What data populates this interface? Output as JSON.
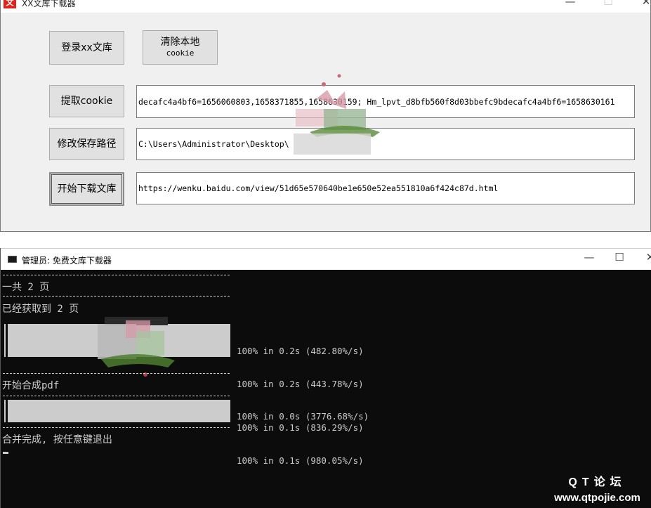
{
  "gui": {
    "title": "XX文库下载器",
    "app_icon_glyph": "文",
    "controls": {
      "minimize": "—",
      "maximize": "☐",
      "close": "✕"
    },
    "buttons": {
      "login": "登录xx文库",
      "clear_line1": "清除本地",
      "clear_line2": "cookie",
      "get_cookie": "提取cookie",
      "change_path": "修改保存路径",
      "start_download": "开始下载文库"
    },
    "fields": {
      "cookie": "decafc4a4bf6=1656060803,1658371855,1658630159; Hm_lpvt_d8bfb560f8d03bbefc9bdecafc4a4bf6=1658630161",
      "path": "C:\\Users\\Administrator\\Desktop\\",
      "url": "https://wenku.baidu.com/view/51d65e570640be1e650e52ea551810a6f424c87d.html"
    }
  },
  "console": {
    "title": "管理员:  免费文库下载器",
    "controls": {
      "minimize": "—",
      "maximize": "☐",
      "close": "✕"
    },
    "lines": {
      "total_pages": "一共 2 页",
      "fetched_pages": "已经获取到 2 页",
      "start_merge": "开始合成pdf",
      "done": "合并完成, 按任意键退出"
    },
    "stats_block1": [
      "100% in 0.2s (482.80%/s)",
      "100% in 0.2s (443.78%/s)",
      "100% in 0.0s (3776.68%/s)"
    ],
    "stats_block2": [
      "100% in 0.1s (836.29%/s)",
      "100% in 0.1s (980.05%/s)"
    ],
    "progress": {
      "download": 1.0,
      "merge": 1.0
    }
  },
  "watermark": {
    "line1": "QT论坛",
    "line2": "www.qtpojie.com"
  },
  "colors": {
    "console_bg": "#0c0c0c",
    "console_text": "#cccccc",
    "window_bg": "#f0f0f0",
    "app_icon": "#e2231a"
  }
}
